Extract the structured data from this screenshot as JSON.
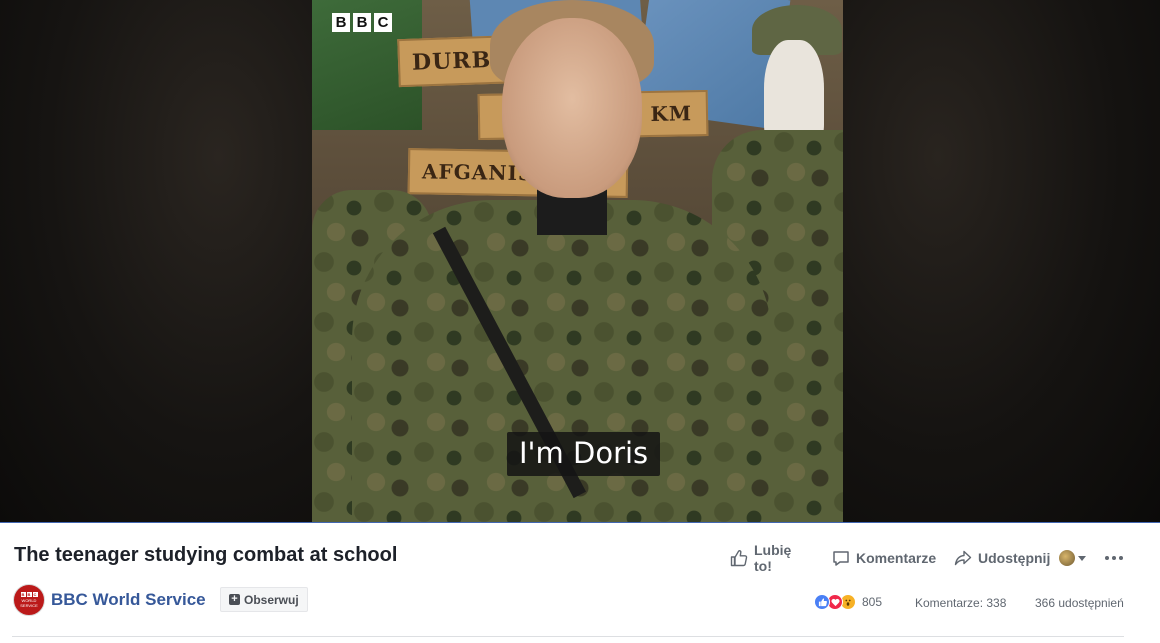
{
  "video": {
    "watermark": [
      "B",
      "B",
      "C"
    ],
    "subtitle": "I'm Doris",
    "scene_signs": [
      "DURBA",
      "I  IN03 KM",
      "AFGANIST"
    ]
  },
  "post": {
    "title": "The teenager studying combat at school"
  },
  "actions": {
    "like_label": "Lubię to!",
    "comment_label": "Komentarze",
    "share_label": "Udostępnij"
  },
  "page": {
    "name": "BBC World Service",
    "follow_label": "Obserwuj",
    "avatar_text": "WORLD SERVICE"
  },
  "stats": {
    "reactions_count": "805",
    "comments": "Komentarze: 338",
    "shares": "366 udostępnień"
  },
  "colors": {
    "link_blue": "#365899",
    "progress_blue": "#4267b2",
    "bbc_red": "#bb1919"
  }
}
